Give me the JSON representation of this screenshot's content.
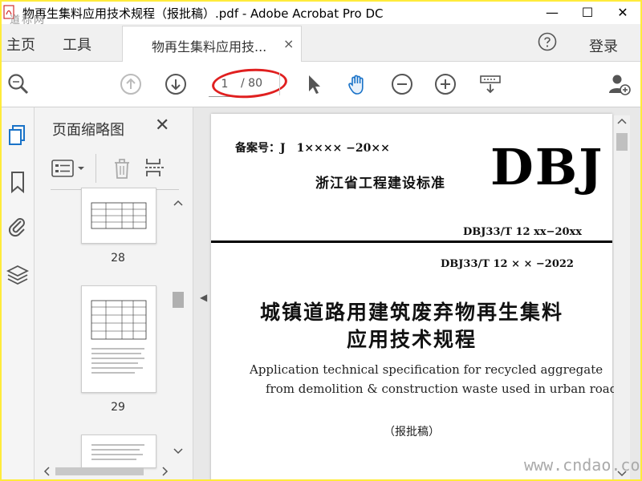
{
  "window": {
    "title": "物再生集料应用技术规程（报批稿）.pdf - Adobe Acrobat Pro DC",
    "watermark_logo": "道标网",
    "minimize": "—",
    "maximize": "☐",
    "close": "✕"
  },
  "menu": {
    "home": "主页",
    "tools": "工具",
    "doc_tab": "物再生集料应用技...",
    "doc_tab_close": "×",
    "login": "登录"
  },
  "toolbar": {
    "page_current": "1",
    "page_total": "/ 80",
    "annotation_color": "#e02020"
  },
  "thumbnails": {
    "title": "页面缩略图",
    "close": "✕",
    "pages": [
      "28",
      "29"
    ]
  },
  "document": {
    "record_no": "备案号：J　1×××× −20××",
    "std_cn": "浙江省工程建设标准",
    "logo": "DBJ",
    "code_old": "DBJ33/T 12 xx−20xx",
    "code_new": "DBJ33/T 12 × ×  −2022",
    "title_line1": "城镇道路用建筑废弃物再生集料",
    "title_line2": "应用技术规程",
    "en_line1": "Application technical specification for recycled aggregate",
    "en_line2": "from demolition & construction waste used in urban road",
    "draft_label": "（报批稿）"
  },
  "site_watermark": "www.cndao.com",
  "colors": {
    "frame": "#ffeb3b",
    "accent_blue": "#1a73c8",
    "pdf_red": "#d32f2f"
  }
}
